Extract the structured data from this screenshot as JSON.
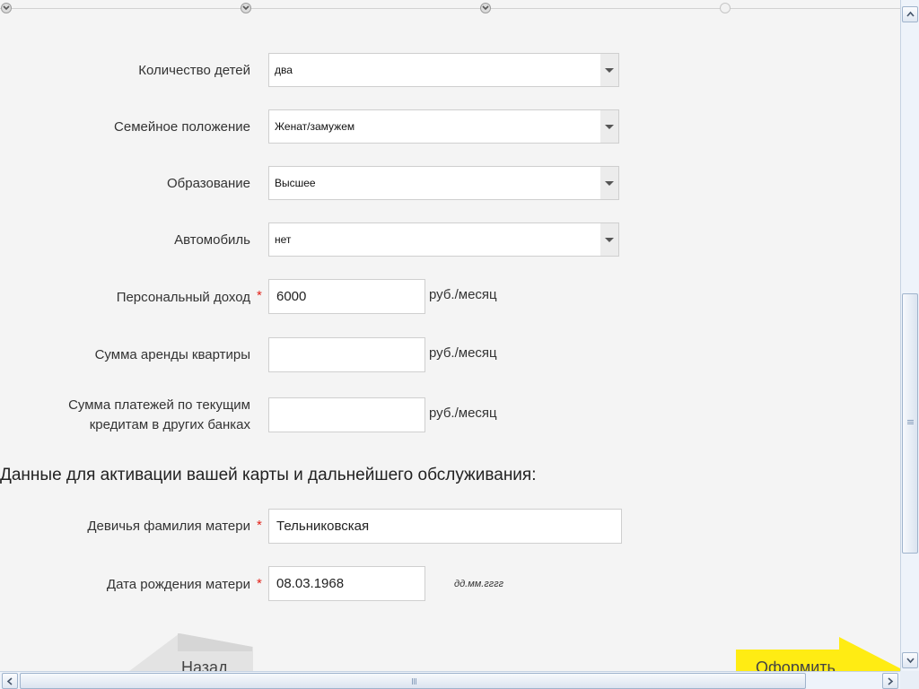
{
  "form": {
    "children_count": {
      "label": "Количество детей",
      "value": "два"
    },
    "marital_status": {
      "label": "Семейное положение",
      "value": "Женат/замужем"
    },
    "education": {
      "label": "Образование",
      "value": "Высшее"
    },
    "car": {
      "label": "Автомобиль",
      "value": "нет"
    },
    "personal_income": {
      "label": "Персональный доход",
      "value": "6000",
      "unit": "руб./месяц",
      "required": "*"
    },
    "rent_amount": {
      "label": "Сумма аренды квартиры",
      "value": "",
      "unit": "руб./месяц"
    },
    "loan_payments": {
      "label_line1": "Сумма платежей по текущим",
      "label_line2": "кредитам в других банках",
      "value": "",
      "unit": "руб./месяц"
    }
  },
  "activation": {
    "section_title": "Данные для активации вашей карты и дальнейшего обслуживания:",
    "mother_maiden_name": {
      "label": "Девичья фамилия матери",
      "value": "Тельниковская",
      "required": "*"
    },
    "mother_birth_date": {
      "label": "Дата рождения матери",
      "value": "08.03.1968",
      "hint": "дд.мм.гггг",
      "required": "*"
    }
  },
  "nav": {
    "back_label": "Назад",
    "next_label": "Оформить"
  },
  "colors": {
    "accent_yellow": "#ffec13",
    "required_red": "#e2231a",
    "page_bg": "#f4f4f4"
  },
  "icons": {
    "dropdown": "triangle-down",
    "step_done": "chevron-down",
    "scroll_up": "triangle-up",
    "scroll_down": "triangle-down",
    "scroll_left": "triangle-left",
    "scroll_right": "triangle-right"
  }
}
